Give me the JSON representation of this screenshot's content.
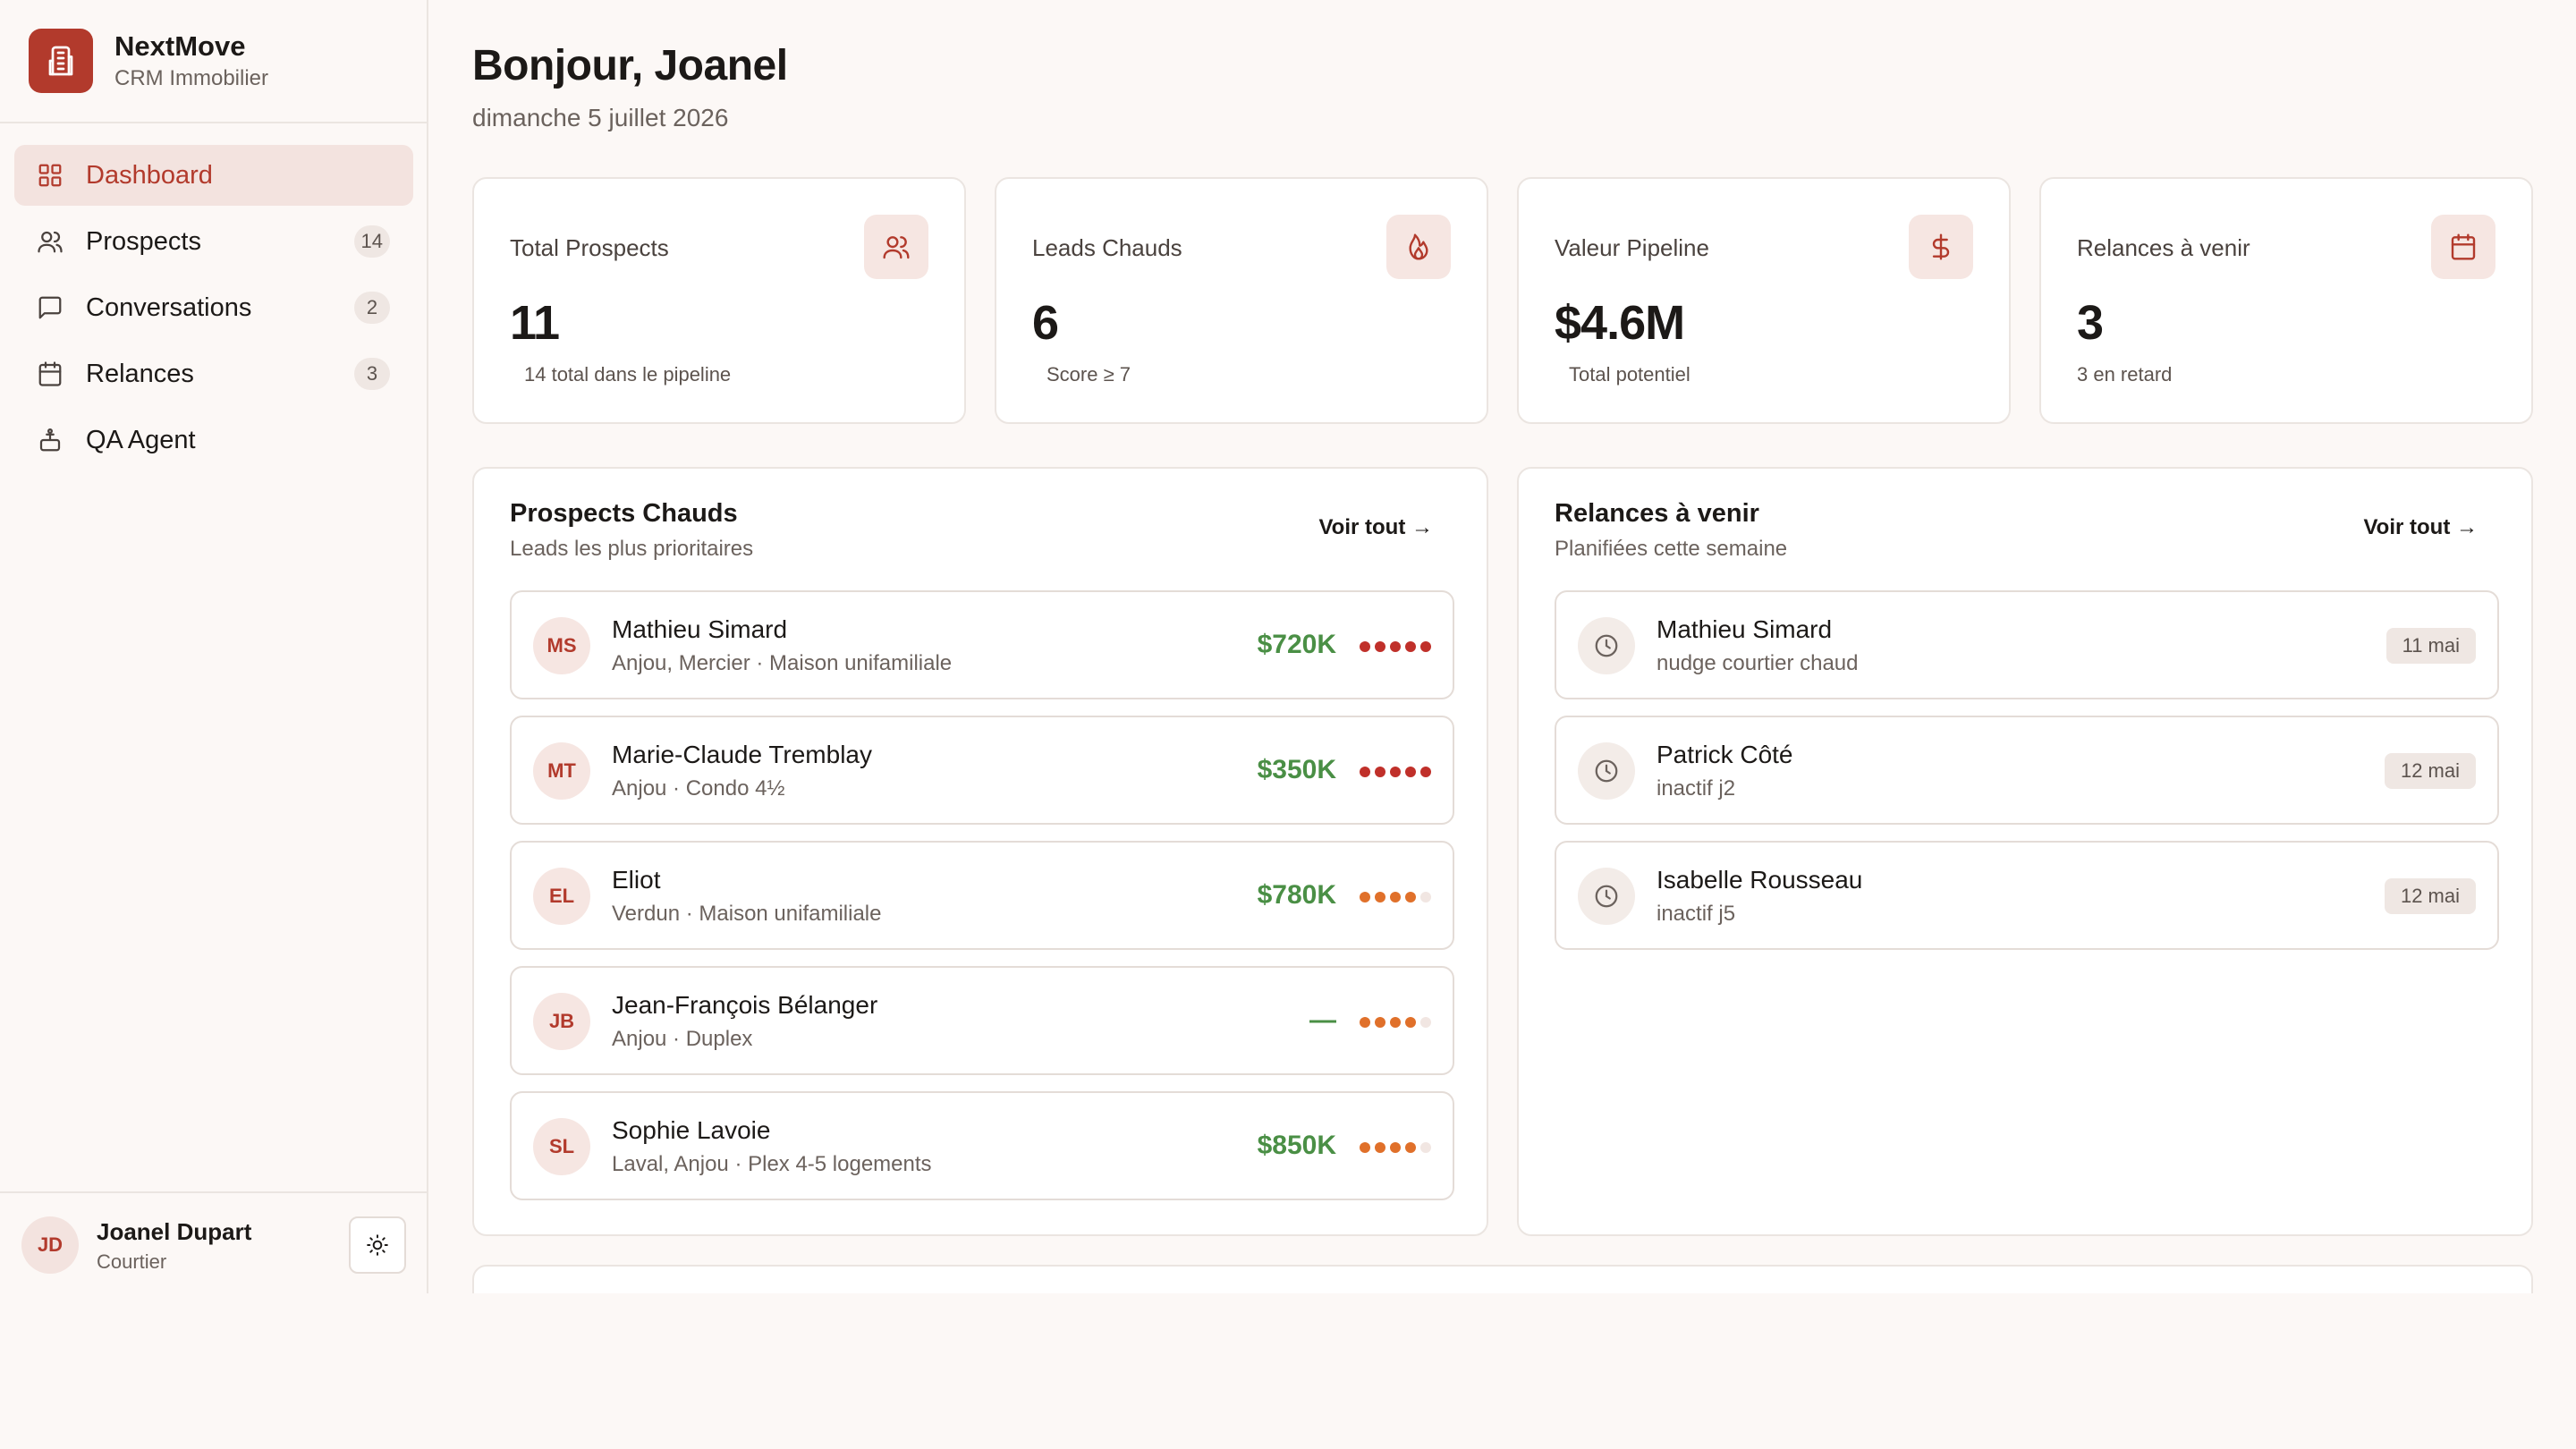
{
  "brand": {
    "name": "NextMove",
    "subtitle": "CRM Immobilier"
  },
  "nav": [
    {
      "label": "Dashboard",
      "icon": "grid-icon",
      "active": true
    },
    {
      "label": "Prospects",
      "icon": "users-icon",
      "badge": "14"
    },
    {
      "label": "Conversations",
      "icon": "message-icon",
      "badge": "2"
    },
    {
      "label": "Relances",
      "icon": "calendar-icon",
      "badge": "3"
    },
    {
      "label": "QA Agent",
      "icon": "bot-icon"
    }
  ],
  "user": {
    "initials": "JD",
    "name": "Joanel Dupart",
    "role": "Courtier"
  },
  "header": {
    "greeting": "Bonjour, Joanel",
    "date": "dimanche 5 juillet 2026"
  },
  "stats": [
    {
      "label": "Total Prospects",
      "value": "11",
      "sub": "14 total dans le pipeline",
      "icon": "users-icon"
    },
    {
      "label": "Leads Chauds",
      "value": "6",
      "sub": "Score ≥ 7",
      "icon": "flame-icon"
    },
    {
      "label": "Valeur Pipeline",
      "value": "$4.6M",
      "sub": "Total potentiel",
      "icon": "dollar-icon"
    },
    {
      "label": "Relances à venir",
      "value": "3",
      "sub": "3 en retard",
      "icon": "calendar-icon"
    }
  ],
  "hot_prospects": {
    "title": "Prospects Chauds",
    "subtitle": "Leads les plus prioritaires",
    "see_all": "Voir tout →",
    "items": [
      {
        "initials": "MS",
        "name": "Mathieu Simard",
        "meta": "Anjou, Mercier · Maison unifamiliale",
        "value": "$720K",
        "score": 5
      },
      {
        "initials": "MT",
        "name": "Marie-Claude Tremblay",
        "meta": "Anjou · Condo 4½",
        "value": "$350K",
        "score": 5
      },
      {
        "initials": "EL",
        "name": "Eliot",
        "meta": "Verdun · Maison unifamiliale",
        "value": "$780K",
        "score": 4
      },
      {
        "initials": "JB",
        "name": "Jean-François Bélanger",
        "meta": "Anjou · Duplex",
        "value": "—",
        "score": 4
      },
      {
        "initials": "SL",
        "name": "Sophie Lavoie",
        "meta": "Laval, Anjou · Plex 4-5 logements",
        "value": "$850K",
        "score": 4
      }
    ]
  },
  "followups": {
    "title": "Relances à venir",
    "subtitle": "Planifiées cette semaine",
    "see_all": "Voir tout →",
    "items": [
      {
        "name": "Mathieu Simard",
        "note": "nudge courtier chaud",
        "date": "11 mai"
      },
      {
        "name": "Patrick Côté",
        "note": "inactif j2",
        "date": "12 mai"
      },
      {
        "name": "Isabelle Rousseau",
        "note": "inactif j5",
        "date": "12 mai"
      }
    ]
  },
  "colors": {
    "accent": "#b23a2c",
    "score_high": "#c0302a",
    "score_mid": "#e0702a",
    "score_empty": "#f1e6e2",
    "value_green": "#4a8f45"
  }
}
